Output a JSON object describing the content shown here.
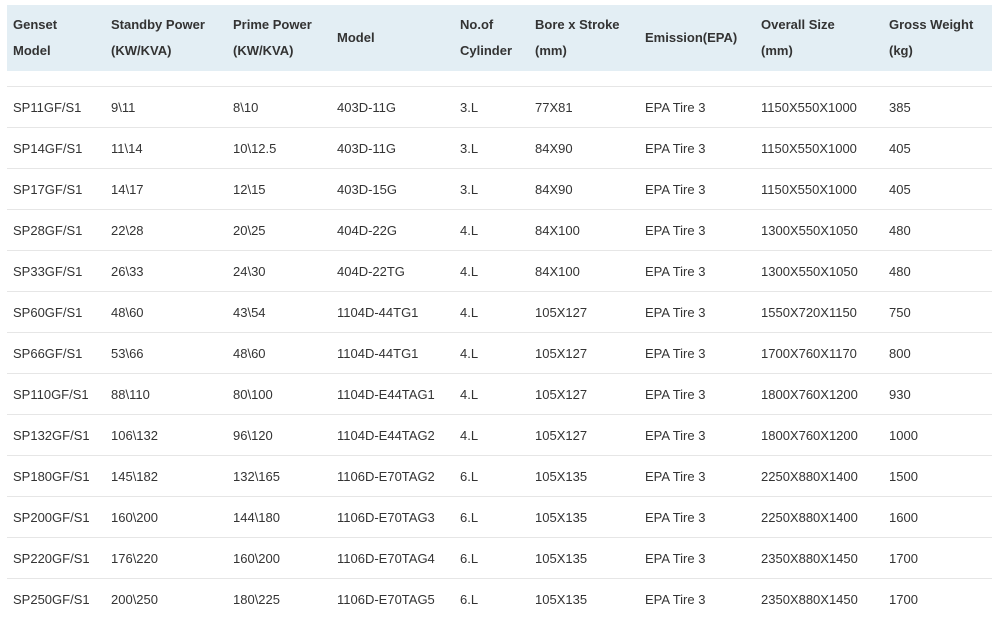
{
  "table": {
    "headers": [
      "Genset\nModel",
      "Standby Power\n(KW/KVA)",
      "Prime Power\n(KW/KVA)",
      "Model",
      "No.of\nCylinder",
      "Bore x Stroke\n(mm)",
      "Emission(EPA)",
      "Overall Size\n(mm)",
      "Gross Weight\n(kg)"
    ],
    "rows": [
      [
        "SP11GF/S1",
        "9\\11",
        "8\\10",
        "403D-11G",
        "3.L",
        "77X81",
        "EPA Tire 3",
        "1150X550X1000",
        "385"
      ],
      [
        "SP14GF/S1",
        "11\\14",
        "10\\12.5",
        "403D-11G",
        "3.L",
        "84X90",
        "EPA Tire 3",
        "1150X550X1000",
        "405"
      ],
      [
        "SP17GF/S1",
        "14\\17",
        "12\\15",
        "403D-15G",
        "3.L",
        "84X90",
        "EPA Tire 3",
        "1150X550X1000",
        "405"
      ],
      [
        "SP28GF/S1",
        "22\\28",
        "20\\25",
        "404D-22G",
        "4.L",
        "84X100",
        "EPA Tire 3",
        "1300X550X1050",
        "480"
      ],
      [
        "SP33GF/S1",
        "26\\33",
        "24\\30",
        "404D-22TG",
        "4.L",
        "84X100",
        "EPA Tire 3",
        "1300X550X1050",
        "480"
      ],
      [
        "SP60GF/S1",
        "48\\60",
        "43\\54",
        "1104D-44TG1",
        "4.L",
        "105X127",
        "EPA Tire 3",
        "1550X720X1150",
        "750"
      ],
      [
        "SP66GF/S1",
        "53\\66",
        "48\\60",
        "1104D-44TG1",
        "4.L",
        "105X127",
        "EPA Tire 3",
        "1700X760X1170",
        "800"
      ],
      [
        "SP110GF/S1",
        "88\\110",
        "80\\100",
        "1104D-E44TAG1",
        "4.L",
        "105X127",
        "EPA Tire 3",
        "1800X760X1200",
        "930"
      ],
      [
        "SP132GF/S1",
        "106\\132",
        "96\\120",
        "1104D-E44TAG2",
        "4.L",
        "105X127",
        "EPA Tire 3",
        "1800X760X1200",
        "1000"
      ],
      [
        "SP180GF/S1",
        "145\\182",
        "132\\165",
        "1106D-E70TAG2",
        "6.L",
        "105X135",
        "EPA Tire 3",
        "2250X880X1400",
        "1500"
      ],
      [
        "SP200GF/S1",
        "160\\200",
        "144\\180",
        "1106D-E70TAG3",
        "6.L",
        "105X135",
        "EPA Tire 3",
        "2250X880X1400",
        "1600"
      ],
      [
        "SP220GF/S1",
        "176\\220",
        "160\\200",
        "1106D-E70TAG4",
        "6.L",
        "105X135",
        "EPA Tire 3",
        "2350X880X1450",
        "1700"
      ],
      [
        "SP250GF/S1",
        "200\\250",
        "180\\225",
        "1106D-E70TAG5",
        "6.L",
        "105X135",
        "EPA Tire 3",
        "2350X880X1450",
        "1700"
      ]
    ]
  }
}
